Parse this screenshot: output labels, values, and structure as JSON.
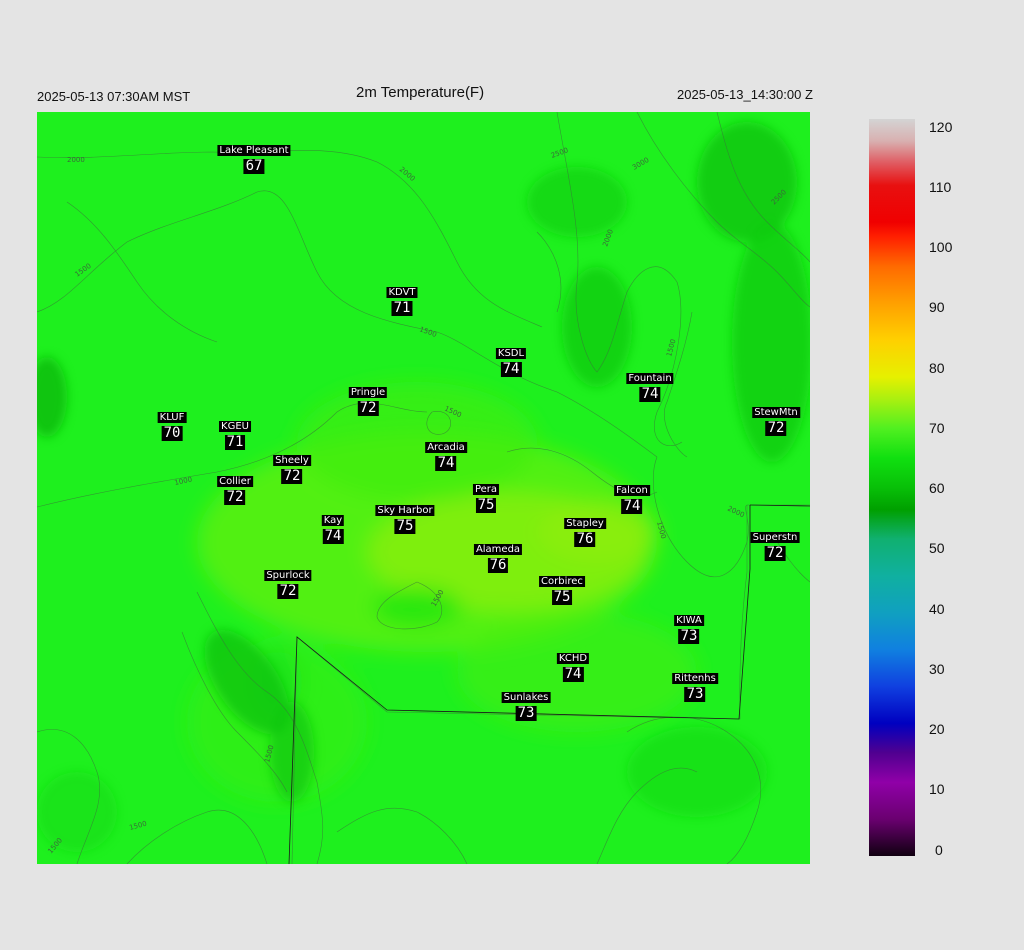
{
  "header": {
    "left_time": "2025-05-13 07:30AM MST",
    "title": "2m Temperature(F)",
    "right_time": "2025-05-13_14:30:00 Z"
  },
  "colorbar": {
    "labels": [
      "120",
      "110",
      "100",
      "90",
      "80",
      "70",
      "60",
      "50",
      "40",
      "30",
      "20",
      "10",
      "0"
    ],
    "range": [
      0,
      120
    ]
  },
  "contour_labels": [
    "2000",
    "1500",
    "1000",
    "2000",
    "2500",
    "3000",
    "2500",
    "2000",
    "1500",
    "1500",
    "1500",
    "1500",
    "2000",
    "1500",
    "1500",
    "1500",
    "1500"
  ],
  "stations": [
    {
      "name": "Lake Pleasant",
      "temp": "67"
    },
    {
      "name": "KDVT",
      "temp": "71"
    },
    {
      "name": "KSDL",
      "temp": "74"
    },
    {
      "name": "Fountain",
      "temp": "74"
    },
    {
      "name": "StewMtn",
      "temp": "72"
    },
    {
      "name": "Pringle",
      "temp": "72"
    },
    {
      "name": "KLUF",
      "temp": "70"
    },
    {
      "name": "KGEU",
      "temp": "71"
    },
    {
      "name": "Arcadia",
      "temp": "74"
    },
    {
      "name": "Sheely",
      "temp": "72"
    },
    {
      "name": "Collier",
      "temp": "72"
    },
    {
      "name": "Pera",
      "temp": "75"
    },
    {
      "name": "Falcon",
      "temp": "74"
    },
    {
      "name": "Kay",
      "temp": "74"
    },
    {
      "name": "Sky Harbor",
      "temp": "75"
    },
    {
      "name": "Stapley",
      "temp": "76"
    },
    {
      "name": "Superstn",
      "temp": "72"
    },
    {
      "name": "Alameda",
      "temp": "76"
    },
    {
      "name": "Spurlock",
      "temp": "72"
    },
    {
      "name": "Corbirec",
      "temp": "75"
    },
    {
      "name": "KIWA",
      "temp": "73"
    },
    {
      "name": "KCHD",
      "temp": "74"
    },
    {
      "name": "Rittenhs",
      "temp": "73"
    },
    {
      "name": "Sunlakes",
      "temp": "73"
    }
  ]
}
